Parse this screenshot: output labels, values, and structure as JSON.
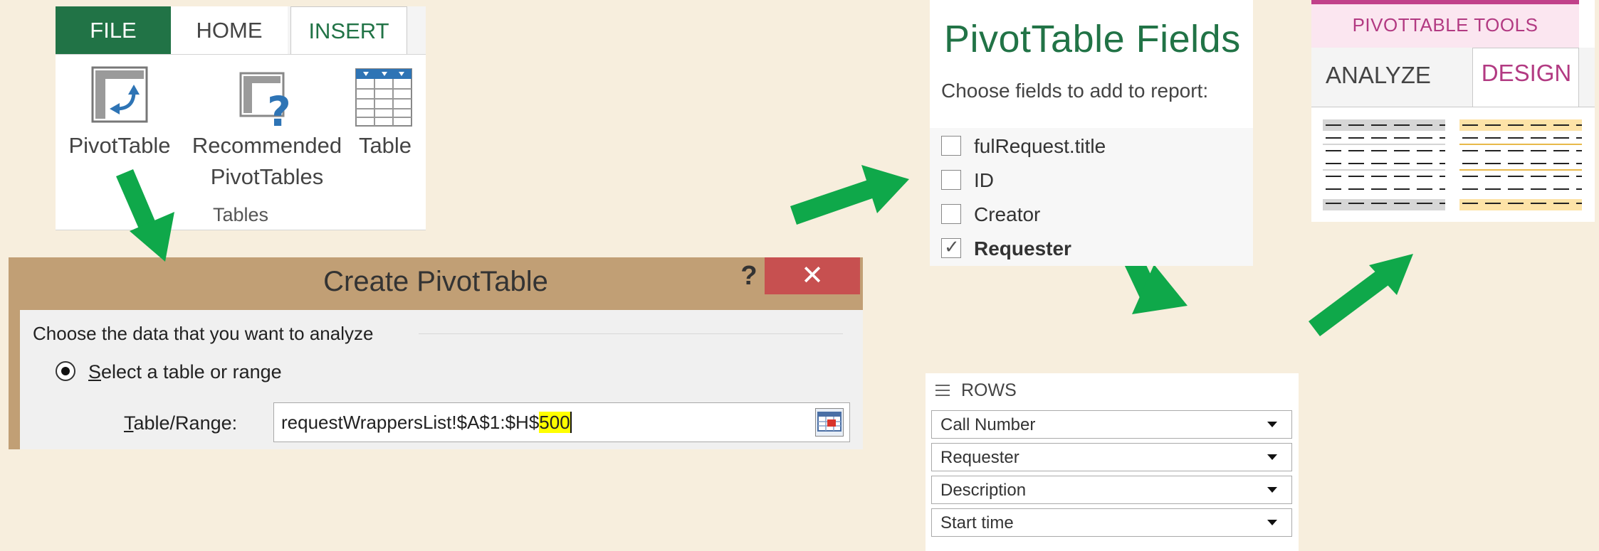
{
  "ribbon": {
    "tabs": [
      "FILE",
      "HOME",
      "INSERT"
    ],
    "commands": {
      "pivot_table": "PivotTable",
      "recommended_line1": "Recommended",
      "recommended_line2": "PivotTables",
      "table": "Table"
    },
    "group_label": "Tables",
    "colors": {
      "file_tab": "#217346",
      "active_tab_text": "#217346"
    }
  },
  "dialog": {
    "title": "Create PivotTable",
    "help": "?",
    "close": "✕",
    "section_label": "Choose the data that you want to analyze",
    "radio": {
      "label_underlined": "S",
      "label_rest": "elect a table or range",
      "selected": true
    },
    "range": {
      "label_underlined": "T",
      "label_rest": "able/Range:",
      "value_prefix": "requestWrappersList!$A$1:$H$",
      "value_highlight": "500"
    },
    "colors": {
      "title_bar": "#c19f75",
      "close_button": "#c75050",
      "highlight": "#ffff00"
    }
  },
  "pivot_fields": {
    "title": "PivotTable Fields",
    "subtitle": "Choose fields to add to report:",
    "fields": [
      {
        "label": "fulRequest.title",
        "checked": false
      },
      {
        "label": "ID",
        "checked": false
      },
      {
        "label": "Creator",
        "checked": false
      },
      {
        "label": "Requester",
        "checked": true
      }
    ]
  },
  "rows_area": {
    "title": "ROWS",
    "items": [
      "Call Number",
      "Requester",
      "Description",
      "Start time"
    ]
  },
  "pivot_tools": {
    "context_title": "PIVOTTABLE TOOLS",
    "tabs": [
      "ANALYZE",
      "DESIGN"
    ],
    "active_tab": "DESIGN",
    "colors": {
      "context": "#c1418a",
      "style_gray": "#d6d6d6",
      "style_gold": "#fde3a7"
    }
  },
  "arrows": {
    "color": "#0fa84a",
    "icon": "flow-arrow-icon"
  }
}
